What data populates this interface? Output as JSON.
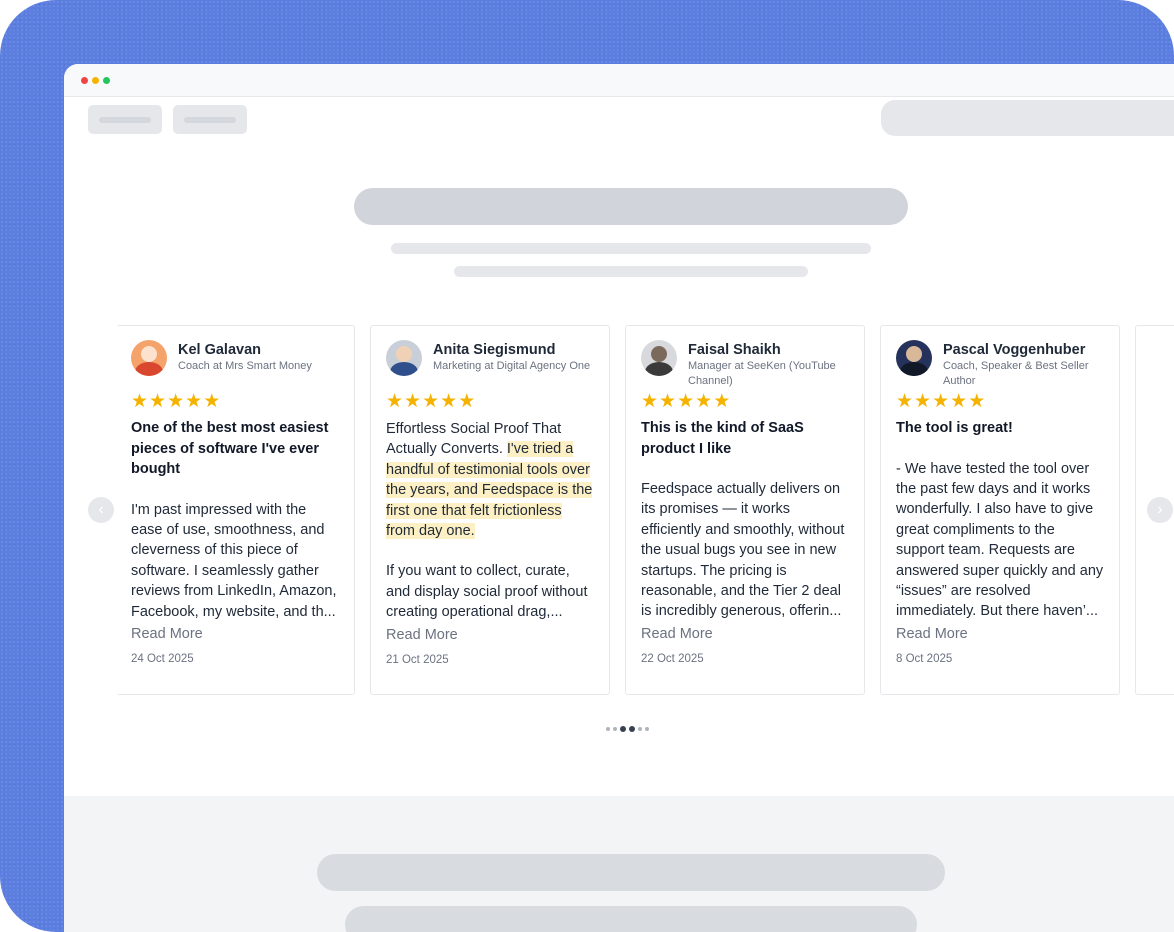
{
  "window": {
    "controls": [
      "close",
      "minimize",
      "maximize"
    ]
  },
  "carousel": {
    "prev_icon": "chevron-left-icon",
    "next_icon": "chevron-right-icon",
    "pagination": {
      "count": 6,
      "active": [
        2,
        3
      ]
    },
    "cards": [
      {
        "name": "Kel Galavan",
        "role": "Coach at Mrs Smart Money",
        "rating": 5,
        "title": "One of the best most easiest pieces of software I've ever bought",
        "body_lead": "",
        "body_highlight": "",
        "body": "I'm past impressed with the ease of use, smoothness, and cleverness of this piece of software. I seamlessly gather reviews from LinkedIn, Amazon, Facebook, my website, and th...",
        "read_more": "Read More",
        "date": "24 Oct 2025"
      },
      {
        "name": "Anita Siegismund",
        "role": "Marketing at Digital Agency One",
        "rating": 5,
        "title": "",
        "body_lead": "Effortless Social Proof That Actually Converts. ",
        "body_highlight": "I've tried a handful of testimonial tools over the years, and Feedspace is the first one that felt frictionless from day one.",
        "body": "If you want to collect, curate, and display social proof without creating operational drag,...",
        "read_more": "Read More",
        "date": "21 Oct 2025"
      },
      {
        "name": "Faisal Shaikh",
        "role": "Manager at SeeKen (YouTube Channel)",
        "rating": 5,
        "title": "This is the kind of SaaS product I like",
        "body_lead": "",
        "body_highlight": "",
        "body": "Feedspace actually delivers on its promises — it works efficiently and smoothly, without the usual bugs you see in new startups. The pricing is reasonable, and the Tier 2 deal is incredibly generous, offerin...",
        "read_more": "Read More",
        "date": "22 Oct 2025"
      },
      {
        "name": "Pascal Voggenhuber",
        "role": "Coach, Speaker & Best Seller Author",
        "rating": 5,
        "title": "The tool is great!",
        "body_lead": "",
        "body_highlight": "",
        "body": "- We have tested the tool over the past few days and it works wonderfully. I also have to give great compliments to the support team. Requests are answered super quickly and any “issues” are resolved immediately. But there haven’...",
        "read_more": "Read More",
        "date": "8 Oct 2025"
      }
    ]
  }
}
